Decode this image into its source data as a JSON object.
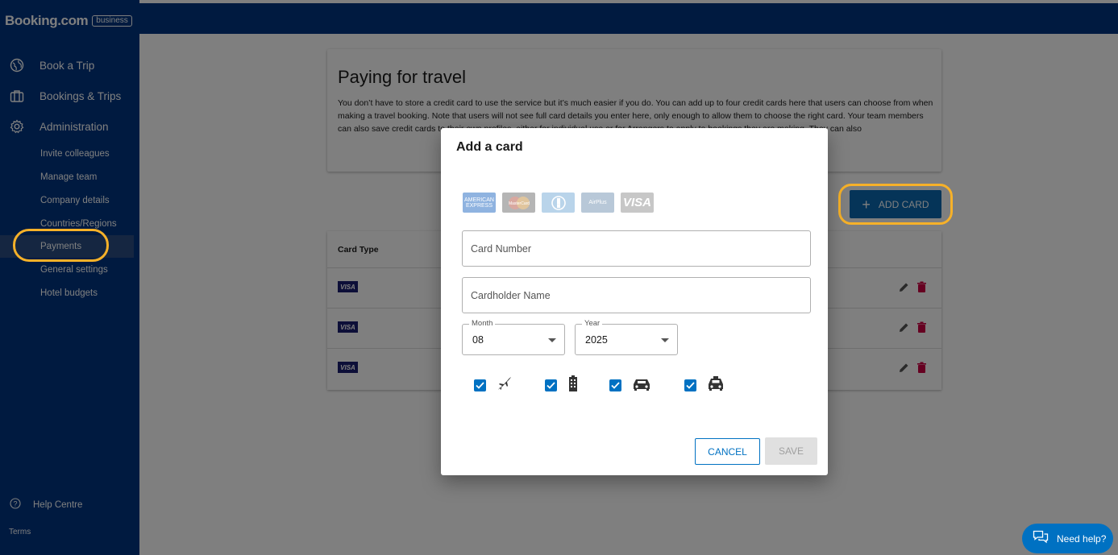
{
  "brand": {
    "logo": "Booking.com",
    "badge": "business"
  },
  "sidebar": {
    "items": [
      {
        "label": "Book a Trip",
        "icon": "globe-icon"
      },
      {
        "label": "Bookings & Trips",
        "icon": "briefcase-icon"
      },
      {
        "label": "Administration",
        "icon": "gear-icon"
      }
    ],
    "subitems": [
      {
        "label": "Invite colleagues"
      },
      {
        "label": "Manage team"
      },
      {
        "label": "Company details"
      },
      {
        "label": "Countries/Regions"
      },
      {
        "label": "Payments",
        "active": true
      },
      {
        "label": "General settings"
      },
      {
        "label": "Hotel budgets"
      }
    ],
    "help": "Help Centre",
    "terms": "Terms"
  },
  "page": {
    "title": "Paying for travel",
    "description": "You don’t have to store a credit card to use the service but it’s much easier if you do. You can add up to four credit cards here that users can choose from when making a travel booking. Note that users will not see full card details you enter here, only enough to allow them to choose the right card. Your team members can also save credit cards to their own profiles, either for individual use or for Arrangers to apply to bookings they are making. They can also",
    "add_card_label": "ADD CARD",
    "table": {
      "header_card_type": "Card Type",
      "rows": [
        {
          "card": "VISA"
        },
        {
          "card": "VISA"
        },
        {
          "card": "VISA"
        }
      ]
    }
  },
  "dialog": {
    "title": "Add a card",
    "brands": [
      "AMERICAN EXPRESS",
      "MasterCard",
      "Diners",
      "AirPlus",
      "VISA"
    ],
    "card_number_placeholder": "Card Number",
    "cardholder_placeholder": "Cardholder Name",
    "month_label": "Month",
    "month_value": "08",
    "year_label": "Year",
    "year_value": "2025",
    "travel_types": [
      {
        "icon": "plane-icon",
        "checked": true
      },
      {
        "icon": "hotel-building-icon",
        "checked": true
      },
      {
        "icon": "car-icon",
        "checked": true
      },
      {
        "icon": "taxi-icon",
        "checked": true
      }
    ],
    "cancel_label": "CANCEL",
    "save_label": "SAVE"
  },
  "chat": {
    "label": "Need help?"
  },
  "colors": {
    "brand_blue": "#003580",
    "accent_blue": "#0071c2",
    "highlight_ring": "#f6b129",
    "delete_red": "#cc0042"
  }
}
